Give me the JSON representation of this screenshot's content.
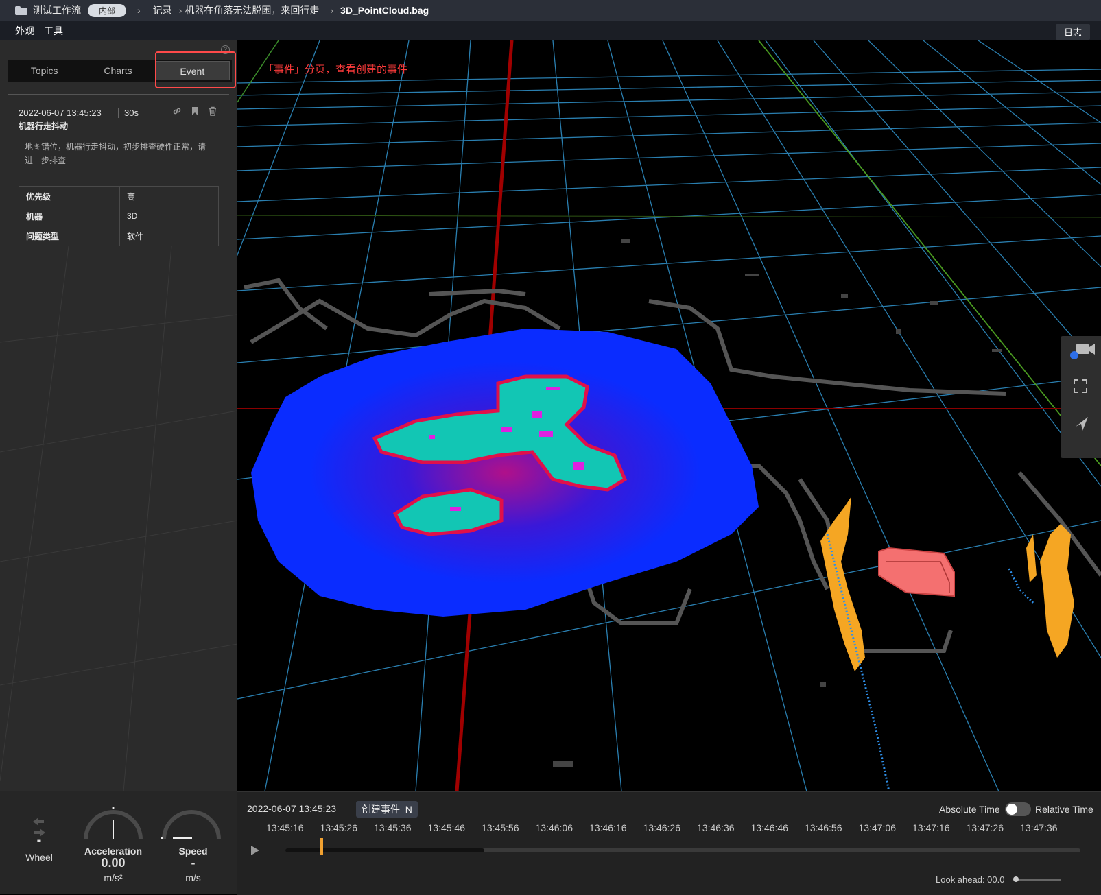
{
  "breadcrumb": {
    "workspace": "测试工作流",
    "badge": "内部",
    "section": "记录",
    "record": "机器在角落无法脱困，来回行走",
    "file": "3D_PointCloud.bag"
  },
  "menu": {
    "appearance": "外观",
    "tools": "工具",
    "log": "日志"
  },
  "tabs": [
    {
      "label": "Topics",
      "active": false
    },
    {
      "label": "Charts",
      "active": false
    },
    {
      "label": "Event",
      "active": true
    }
  ],
  "annotation": "「事件」分页，查看创建的事件",
  "event": {
    "time": "2022-06-07 13:45:23",
    "duration": "30s",
    "title": "机器行走抖动",
    "description": "地图错位，机器行走抖动，初步排查硬件正常，请进一步排查",
    "properties": [
      {
        "key": "优先级",
        "value": "高"
      },
      {
        "key": "机器",
        "value": "3D"
      },
      {
        "key": "问题类型",
        "value": "软件"
      }
    ]
  },
  "dashboard": {
    "wheel": {
      "value": "-",
      "label": "Wheel"
    },
    "acceleration": {
      "label": "Acceleration",
      "value": "0.00",
      "unit": "m/s²"
    },
    "speed": {
      "label": "Speed",
      "value": "-",
      "unit": "m/s"
    }
  },
  "timeline": {
    "current": "2022-06-07 13:45:23",
    "create_event": "创建事件",
    "shortcut": "N",
    "absolute": "Absolute Time",
    "relative": "Relative Time",
    "relative_enabled": false,
    "ticks": [
      "13:45:16",
      "13:45:26",
      "13:45:36",
      "13:45:46",
      "13:45:56",
      "13:46:06",
      "13:46:16",
      "13:46:26",
      "13:46:36",
      "13:46:46",
      "13:46:56",
      "13:47:06",
      "13:47:16",
      "13:47:26",
      "13:47:36"
    ],
    "look_ahead": "Look ahead: 00.0"
  },
  "colors": {
    "accent_red": "#ff3b3b",
    "grid": "#2a7fb0",
    "cost_blue": "#0a2cff",
    "cost_cyan": "#12c6b4",
    "cost_magenta": "#e020e0",
    "pointcloud_orange": "#f5a623",
    "trajectory_blue": "#2e8fe8",
    "obstacle_red": "#f47070"
  }
}
